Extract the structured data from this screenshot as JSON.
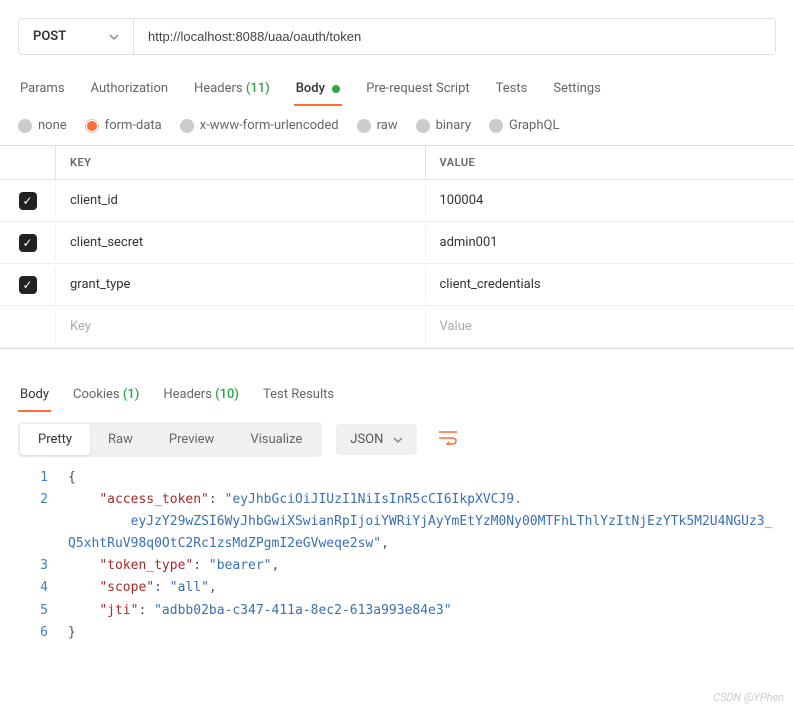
{
  "request": {
    "method": "POST",
    "url": "http://localhost:8088/uaa/oauth/token"
  },
  "tabs": {
    "params": "Params",
    "auth": "Authorization",
    "headers": "Headers",
    "headers_count": "(11)",
    "body": "Body",
    "prerequest": "Pre-request Script",
    "tests": "Tests",
    "settings": "Settings"
  },
  "body_types": {
    "none": "none",
    "formdata": "form-data",
    "xwww": "x-www-form-urlencoded",
    "raw": "raw",
    "binary": "binary",
    "graphql": "GraphQL"
  },
  "table": {
    "header_key": "KEY",
    "header_value": "VALUE",
    "rows": [
      {
        "key": "client_id",
        "value": "100004"
      },
      {
        "key": "client_secret",
        "value": "admin001"
      },
      {
        "key": "grant_type",
        "value": "client_credentials"
      }
    ],
    "placeholder_key": "Key",
    "placeholder_value": "Value"
  },
  "response": {
    "tabs": {
      "body": "Body",
      "cookies": "Cookies",
      "cookies_count": "(1)",
      "headers": "Headers",
      "headers_count": "(10)",
      "tests": "Test Results"
    },
    "modes": {
      "pretty": "Pretty",
      "raw": "Raw",
      "preview": "Preview",
      "visualize": "Visualize"
    },
    "content_type": "JSON",
    "json": {
      "access_token": "eyJhbGciOiJIUzI1NiIsInR5cCI6IkpXVCJ9.eyJzY29wZSI6WyJhbGwiXSwianRpIjoiYWRiYjAyYmEtYzM0Ny00MTFhLThlYzItNjEzYTk5M2U4NGUz3_Q5xhtRuV98q0OtC2Rc1zsMdZPgmI2eGVweqe2sw",
      "token_type": "bearer",
      "scope": "all",
      "jti": "adbb02ba-c347-411a-8ec2-613a993e84e3"
    }
  },
  "watermark": "CSDN @YPhen"
}
